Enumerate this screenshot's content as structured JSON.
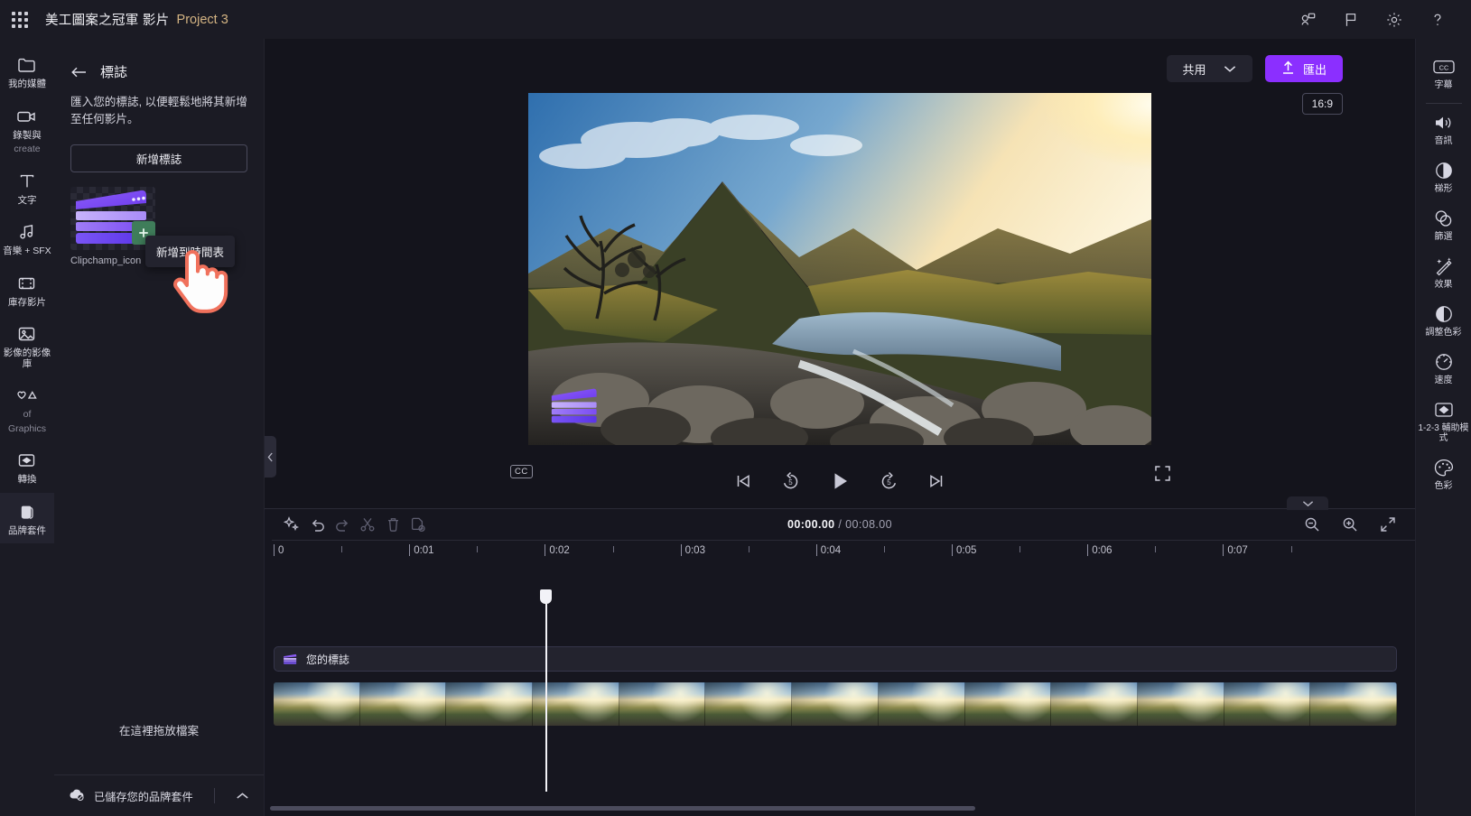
{
  "topbar": {
    "waffle_icon": "app-launcher-icon",
    "title": "美工圖案之冠軍  影片",
    "project": "Project 3",
    "icons": [
      {
        "name": "feedback-icon",
        "label": "意見反應"
      },
      {
        "name": "flag-icon",
        "label": "標記"
      },
      {
        "name": "gear-icon",
        "label": "設定"
      },
      {
        "name": "help-icon",
        "label": "說明"
      }
    ]
  },
  "left_rail": [
    {
      "name": "sidebar-item-media",
      "icon": "folder-icon",
      "label": "我的媒體",
      "label2": "",
      "active": false
    },
    {
      "name": "sidebar-item-record",
      "icon": "camera-icon",
      "label": "錄製與",
      "label2": "create",
      "active": false
    },
    {
      "name": "sidebar-item-text",
      "icon": "text-icon",
      "label": "文字",
      "label2": "",
      "active": false
    },
    {
      "name": "sidebar-item-music-sfx",
      "icon": "music-icon",
      "label": "音樂 + SFX",
      "label2": "",
      "active": false
    },
    {
      "name": "sidebar-item-stock-video",
      "icon": "filmstrip-icon",
      "label": "庫存影片",
      "label2": "",
      "active": false
    },
    {
      "name": "sidebar-item-image-lib",
      "icon": "image-icon",
      "label": "影像的影像庫",
      "label2": "",
      "active": false
    },
    {
      "name": "sidebar-item-graphics",
      "icon": "shapes-icon",
      "label": "of",
      "label2": "Graphics",
      "active": false
    },
    {
      "name": "sidebar-item-transitions",
      "icon": "transition-icon",
      "label": "轉換",
      "label2": "",
      "active": false
    },
    {
      "name": "sidebar-item-brand-kit",
      "icon": "brand-kit-icon",
      "label": "品牌套件",
      "label2": "",
      "active": true
    }
  ],
  "panel": {
    "back_icon": "back-arrow-icon",
    "title": "標誌",
    "description": "匯入您的標誌, 以便輕鬆地將其新增至任何影片。",
    "add_logo_label": "新增標誌",
    "asset": {
      "name": "Clipchamp_icon",
      "plus_icon": "add-to-timeline-icon",
      "tooltip": "新增到時間表"
    },
    "dropzone_label": "在這裡拖放檔案",
    "footer": {
      "cloud_icon": "cloud-saved-icon",
      "label": "已儲存您的品牌套件",
      "chevron_icon": "chevron-up-icon"
    },
    "collapse_icon": "collapse-panel-icon"
  },
  "stage": {
    "share_label": "共用",
    "share_chevron_icon": "chevron-down-icon",
    "export_label": "匯出",
    "export_icon": "upload-arrow-icon",
    "export_color": "#8b2fff",
    "aspect_ratio": "16:9",
    "player": {
      "cc_label": "CC",
      "buttons": [
        {
          "name": "skip-previous-button",
          "icon": "skip-previous-icon"
        },
        {
          "name": "rewind-5-button",
          "icon": "rewind-5-icon",
          "label": "5"
        },
        {
          "name": "play-button",
          "icon": "play-icon"
        },
        {
          "name": "forward-5-button",
          "icon": "forward-5-icon",
          "label": "5"
        },
        {
          "name": "skip-next-button",
          "icon": "skip-next-icon"
        }
      ],
      "fullscreen_icon": "fullscreen-icon"
    }
  },
  "timeline": {
    "tools": [
      {
        "name": "magic-tools-button",
        "icon": "sparkle-icon",
        "dim": false
      },
      {
        "name": "undo-button",
        "icon": "undo-icon",
        "dim": false
      },
      {
        "name": "redo-button",
        "icon": "redo-icon",
        "dim": true
      },
      {
        "name": "split-button",
        "icon": "scissors-icon",
        "dim": true
      },
      {
        "name": "delete-button",
        "icon": "trash-icon",
        "dim": true
      },
      {
        "name": "duplicate-button",
        "icon": "duplicate-icon",
        "dim": true
      }
    ],
    "current_time": "00:00.00",
    "total_time": "/ 00:08.00",
    "zoom_tools": [
      {
        "name": "zoom-out-button",
        "icon": "zoom-out-icon"
      },
      {
        "name": "zoom-in-button",
        "icon": "zoom-in-icon"
      },
      {
        "name": "fit-button",
        "icon": "fit-timeline-icon"
      }
    ],
    "ruler_labels": [
      "0",
      "0:01",
      "0:02",
      "0:03",
      "0:04",
      "0:05",
      "0:06",
      "0:07"
    ],
    "logo_track_label": "您的標誌",
    "collapse_icon": "chevron-down-icon"
  },
  "right_rail": [
    {
      "name": "tool-captions",
      "icon": "cc-icon",
      "label": "字幕",
      "divider_after": true
    },
    {
      "name": "tool-audio",
      "icon": "speaker-icon",
      "label": "音訊",
      "divider_after": false
    },
    {
      "name": "tool-fade",
      "icon": "fade-icon",
      "label": "梯形",
      "divider_after": false
    },
    {
      "name": "tool-filters",
      "icon": "filters-icon",
      "label": "篩選",
      "divider_after": false
    },
    {
      "name": "tool-effects",
      "icon": "wand-icon",
      "label": "效果",
      "divider_after": false
    },
    {
      "name": "tool-adjust-color",
      "icon": "contrast-icon",
      "label": "調整色彩",
      "divider_after": false
    },
    {
      "name": "tool-speed",
      "icon": "speed-icon",
      "label": "速度",
      "divider_after": false
    },
    {
      "name": "tool-assist-mode",
      "icon": "transition-icon",
      "label": "1-2-3 輔助模式",
      "divider_after": false
    },
    {
      "name": "tool-color",
      "icon": "palette-icon",
      "label": "色彩",
      "divider_after": false
    }
  ]
}
